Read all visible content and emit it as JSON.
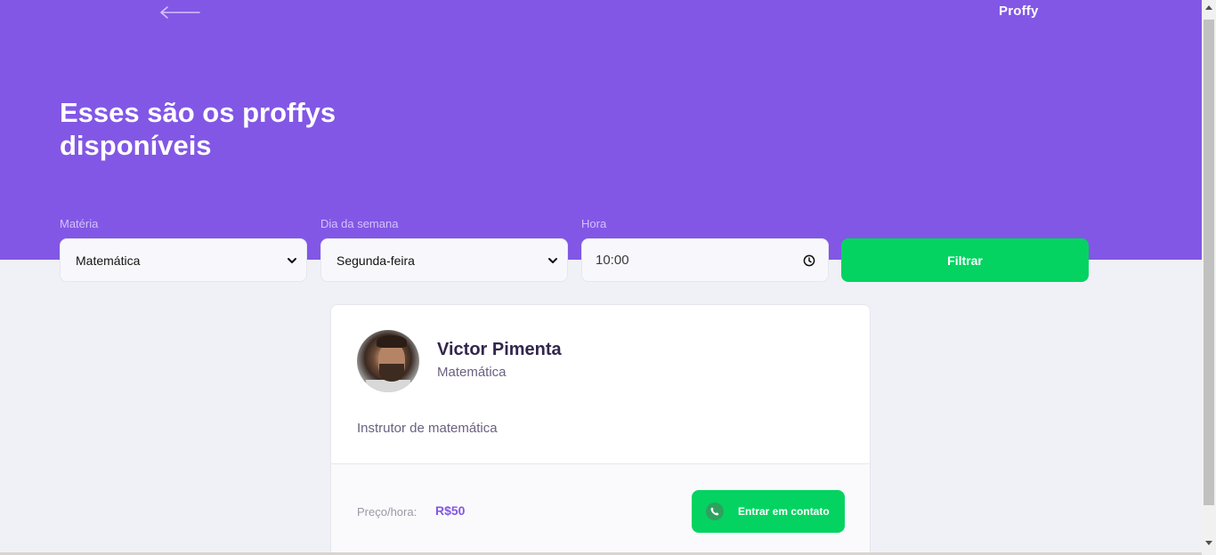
{
  "header": {
    "brand": "Proffy",
    "title": "Esses são os proffys disponíveis"
  },
  "filters": {
    "subject": {
      "label": "Matéria",
      "value": "Matemática"
    },
    "weekday": {
      "label": "Dia da semana",
      "value": "Segunda-feira"
    },
    "time": {
      "label": "Hora",
      "value": "10:00"
    },
    "submit_label": "Filtrar"
  },
  "teacher": {
    "name": "Victor Pimenta",
    "subject": "Matemática",
    "bio": "Instrutor de matemática",
    "price_label": "Preço/hora:",
    "price": "R$50",
    "contact_label": "Entrar em contato"
  },
  "colors": {
    "primary": "#8257e5",
    "secondary": "#04d361",
    "background": "#f0f0f7"
  },
  "icons": {
    "back": "arrow-left-icon",
    "select_caret": "chevron-down-icon",
    "clock": "clock-icon",
    "contact": "whatsapp-icon"
  }
}
